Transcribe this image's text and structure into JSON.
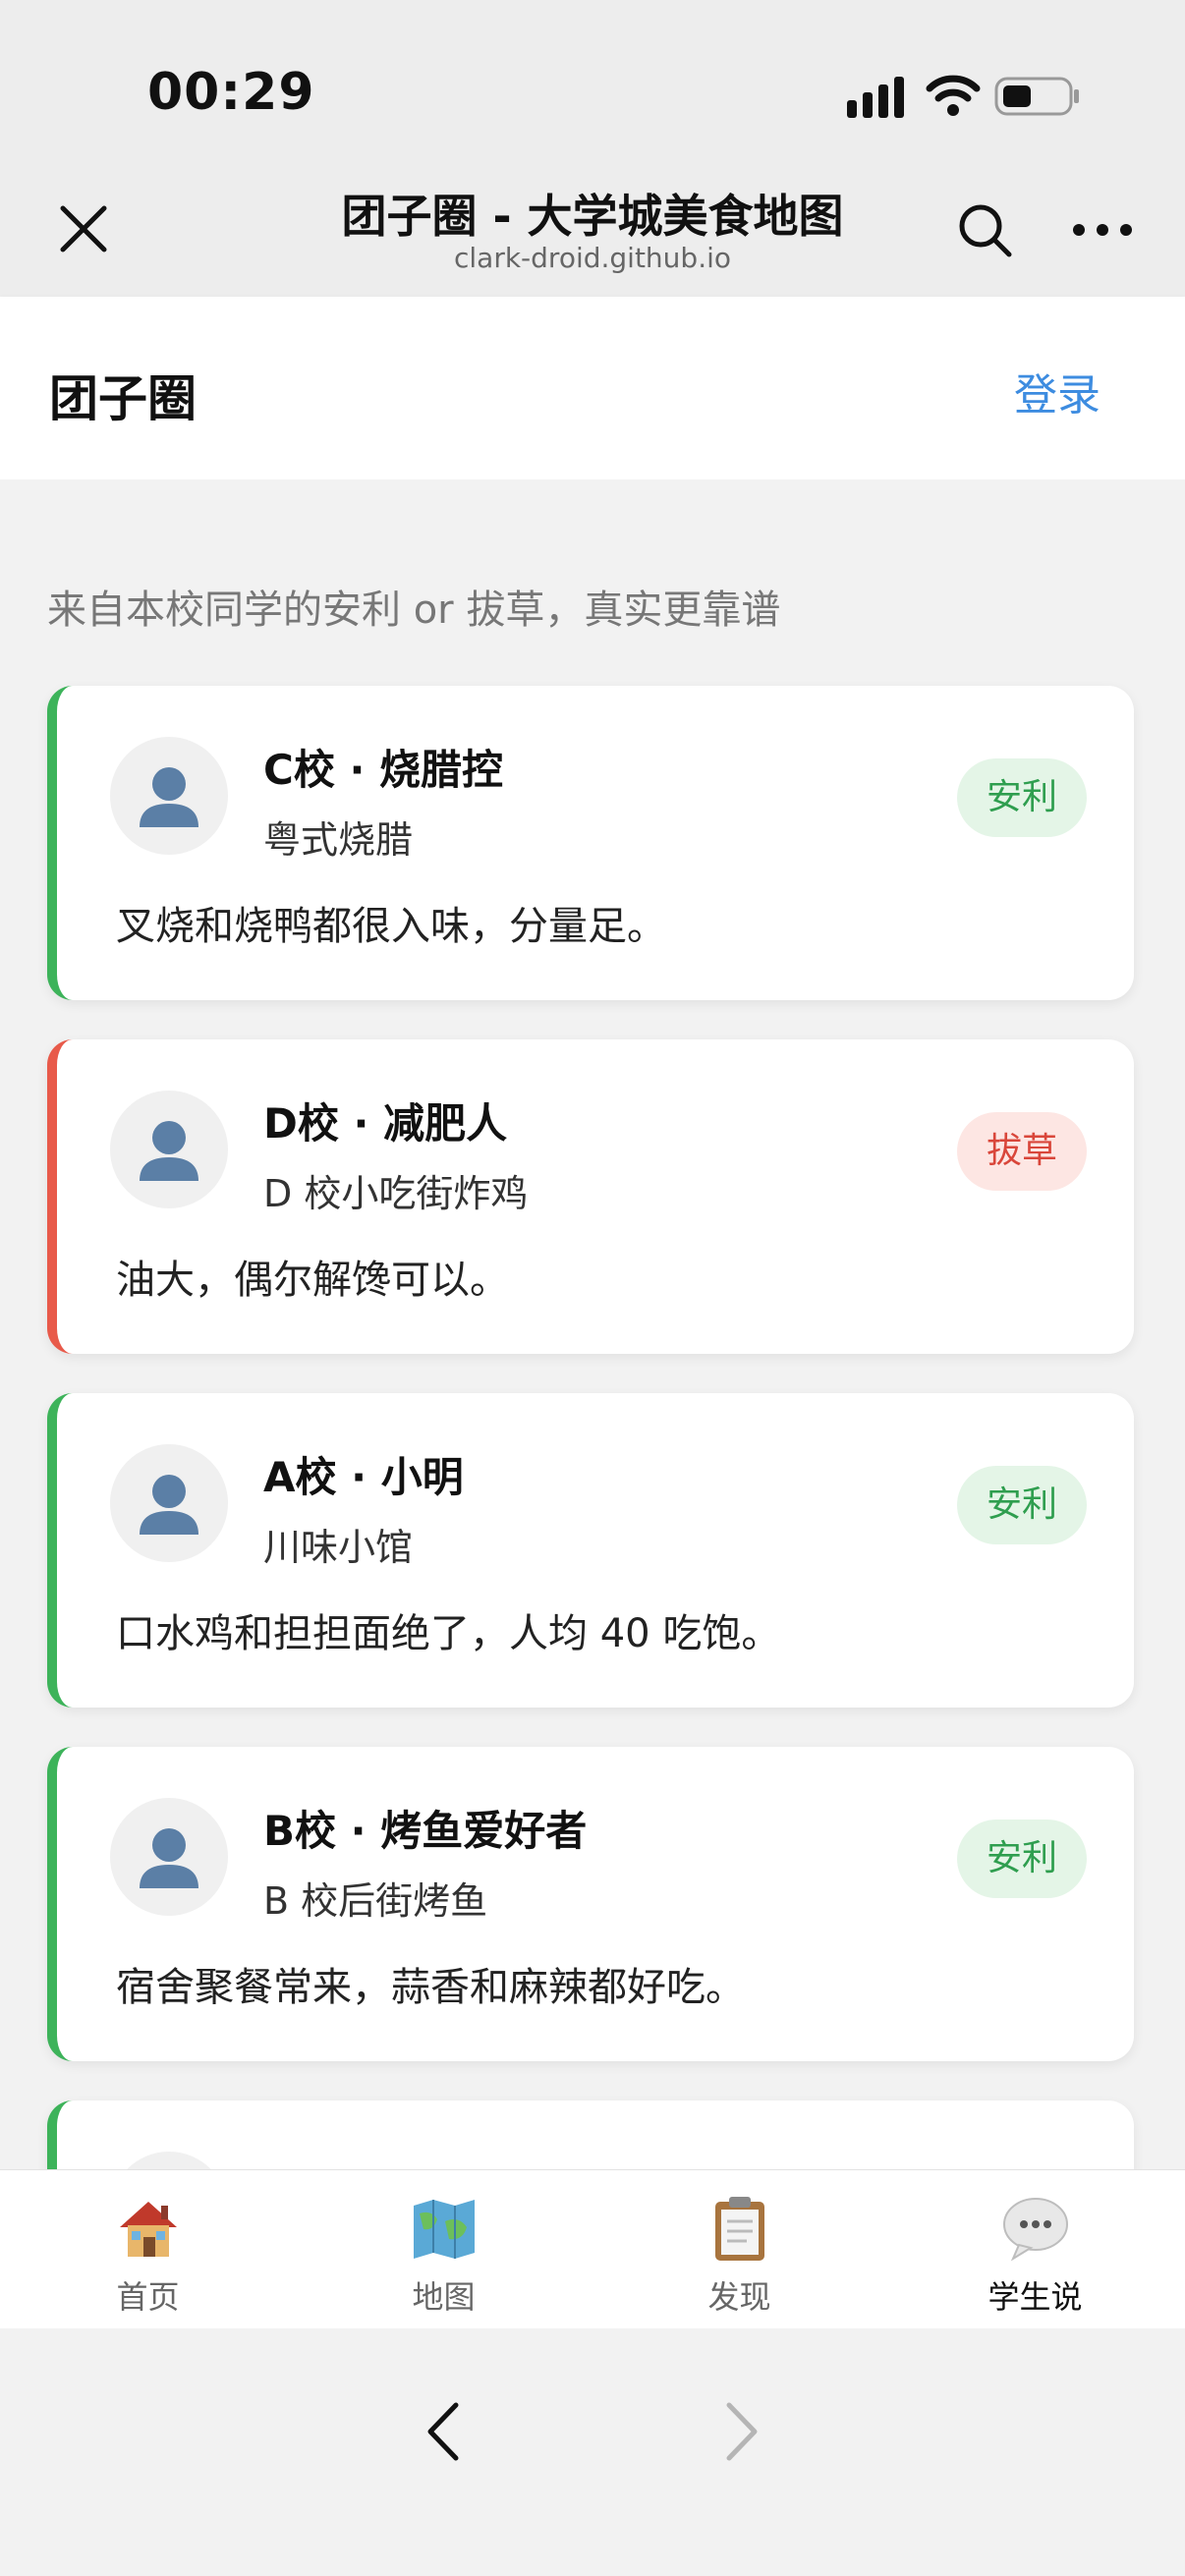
{
  "status_bar": {
    "time": "00:29"
  },
  "nav": {
    "title": "团子圈 - 大学城美食地图",
    "subtitle": "clark-droid.github.io"
  },
  "header": {
    "title": "团子圈",
    "login": "登录"
  },
  "feed": {
    "subtitle": "来自本校同学的安利 or 拔草，真实更靠谱",
    "items": [
      {
        "author": "C校 · 烧腊控",
        "place": "粤式烧腊",
        "text": "叉烧和烧鸭都很入味，分量足。",
        "tag": "安利",
        "kind": "good"
      },
      {
        "author": "D校 · 减肥人",
        "place": "D 校小吃街炸鸡",
        "text": "油大，偶尔解馋可以。",
        "tag": "拔草",
        "kind": "bad"
      },
      {
        "author": "A校 · 小明",
        "place": "川味小馆",
        "text": "口水鸡和担担面绝了，人均 40 吃饱。",
        "tag": "安利",
        "kind": "good"
      },
      {
        "author": "B校 · 烤鱼爱好者",
        "place": "B 校后街烤鱼",
        "text": "宿舍聚餐常来，蒜香和麻辣都好吃。",
        "tag": "安利",
        "kind": "good"
      }
    ]
  },
  "tabs": [
    {
      "label": "首页",
      "icon": "house-icon"
    },
    {
      "label": "地图",
      "icon": "map-icon"
    },
    {
      "label": "发现",
      "icon": "clipboard-icon"
    },
    {
      "label": "学生说",
      "icon": "speech-bubble-icon",
      "active": true
    }
  ],
  "colors": {
    "accent_link": "#3d8ce0",
    "positive": "#3db35a",
    "negative": "#e85a4a"
  }
}
